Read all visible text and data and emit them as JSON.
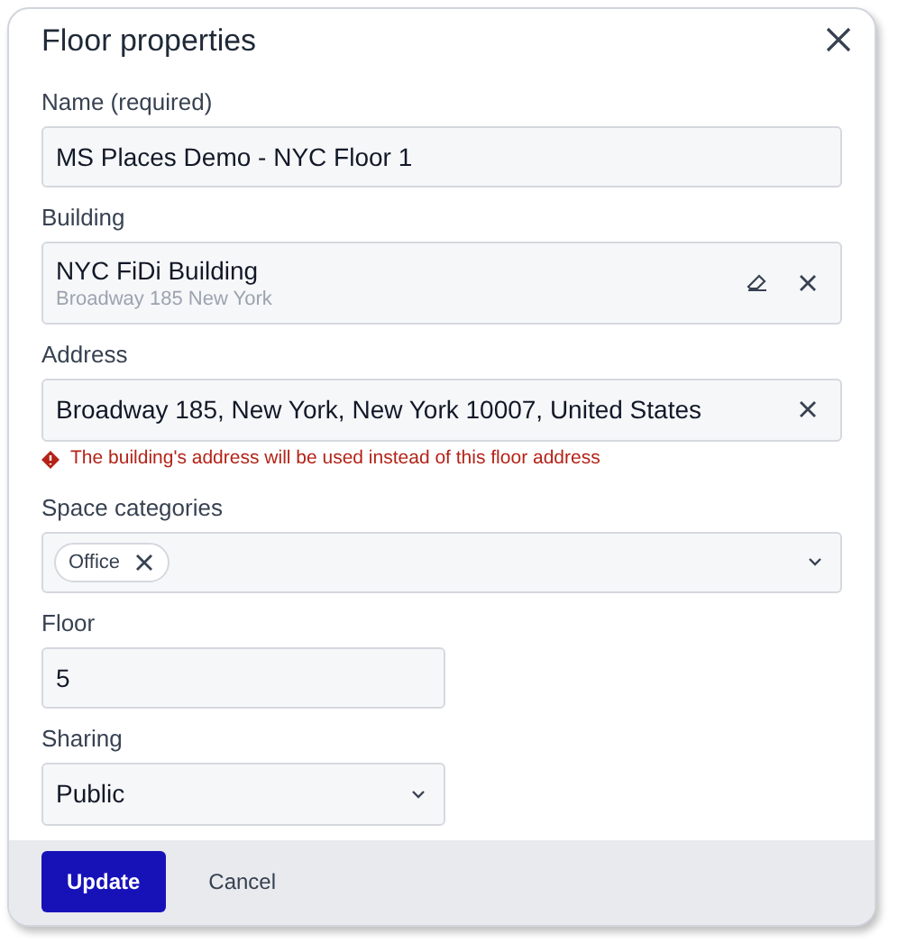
{
  "dialog": {
    "title": "Floor properties"
  },
  "fields": [
    {
      "kind": "text",
      "label": "Name (required)",
      "value": "MS Places Demo - NYC Floor 1",
      "wide": true
    },
    {
      "kind": "building",
      "label": "Building",
      "value": "NYC FiDi Building",
      "subtitle": "Broadway 185 New York"
    },
    {
      "kind": "address",
      "label": "Address",
      "value": "Broadway 185, New York, New York 10007, United States",
      "warning": "The building's address will be used instead of this floor address"
    },
    {
      "kind": "tags",
      "label": "Space categories",
      "tags": [
        "Office"
      ]
    },
    {
      "kind": "text",
      "label": "Floor",
      "value": "5",
      "wide": false
    },
    {
      "kind": "select",
      "label": "Sharing",
      "value": "Public"
    }
  ],
  "buttons": [
    {
      "label": "Update",
      "primary": true
    },
    {
      "label": "Cancel",
      "primary": false
    }
  ]
}
